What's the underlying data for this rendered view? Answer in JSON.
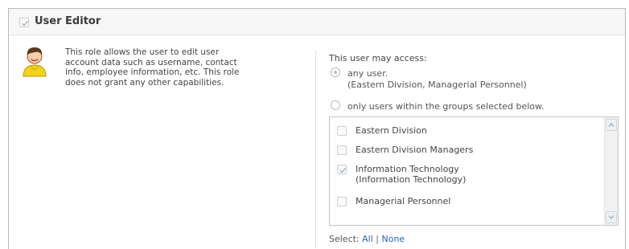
{
  "header": {
    "title": "User Editor",
    "checkbox_checked": true
  },
  "description": {
    "text": "This role allows the user to edit user\naccount data such as username, contact\ninfo, employee information, etc. This role\ndoes not grant any other capabilities."
  },
  "access": {
    "label": "This user may access:",
    "options": [
      {
        "label": "any user.",
        "sublabel": "(Eastern Division, Managerial Personnel)",
        "checked": true
      },
      {
        "label": "only users within the groups selected below.",
        "checked": false
      }
    ],
    "groups": [
      {
        "name": "Eastern Division",
        "checked": false
      },
      {
        "name": "Eastern Division Managers",
        "checked": false
      },
      {
        "name": "Information Technology",
        "sub": "(Information Technology)",
        "checked": true
      },
      {
        "name": "Managerial Personnel",
        "checked": false
      }
    ]
  },
  "select": {
    "label": "Select:",
    "all": "All",
    "separator": "|",
    "none": "None"
  },
  "icons": {
    "checkmark": "checkmark-icon",
    "avatar": "user-avatar-icon",
    "scroll_up": "chevron-up-icon",
    "scroll_down": "chevron-down-icon"
  },
  "colors": {
    "link": "#2a63b8",
    "border": "#b9b9b9",
    "header_bg": "#f7f7f7"
  }
}
